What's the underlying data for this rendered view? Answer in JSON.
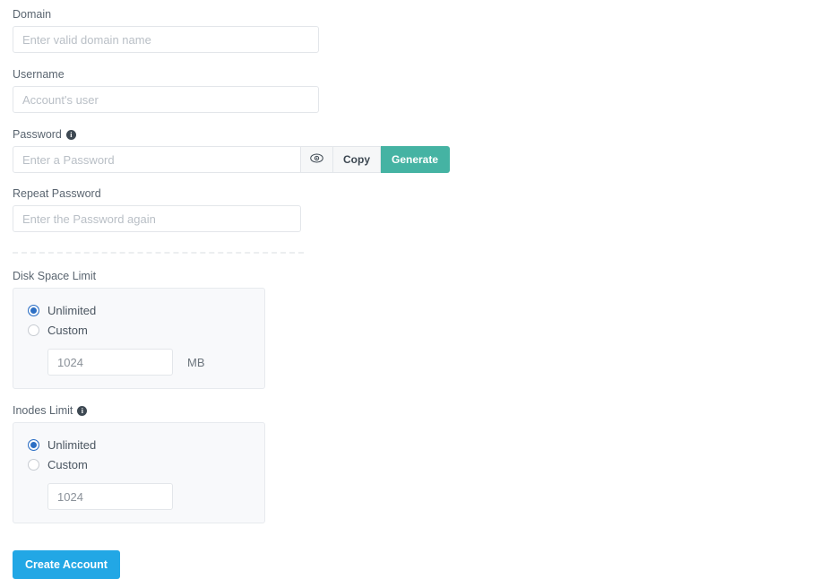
{
  "form": {
    "domain": {
      "label": "Domain",
      "placeholder": "Enter valid domain name",
      "value": ""
    },
    "username": {
      "label": "Username",
      "placeholder": "Account's user",
      "value": ""
    },
    "password": {
      "label": "Password",
      "info_glyph": "i",
      "placeholder": "Enter a Password",
      "value": "",
      "toggle_icon": "eye-icon",
      "copy_label": "Copy",
      "generate_label": "Generate",
      "generate_color": "#45b3a3"
    },
    "repeat_password": {
      "label": "Repeat Password",
      "placeholder": "Enter the Password again",
      "value": ""
    },
    "disk_space_limit": {
      "label": "Disk Space Limit",
      "options": [
        {
          "label": "Unlimited",
          "selected": true
        },
        {
          "label": "Custom",
          "selected": false
        }
      ],
      "amount_value": "1024",
      "unit": "MB",
      "radio_color": "#2c6fc4"
    },
    "inodes_limit": {
      "label": "Inodes Limit",
      "info_glyph": "i",
      "options": [
        {
          "label": "Unlimited",
          "selected": true
        },
        {
          "label": "Custom",
          "selected": false
        }
      ],
      "amount_value": "1024",
      "unit": "",
      "radio_color": "#2c6fc4"
    },
    "submit": {
      "label": "Create Account",
      "color": "#22a7e5"
    }
  }
}
